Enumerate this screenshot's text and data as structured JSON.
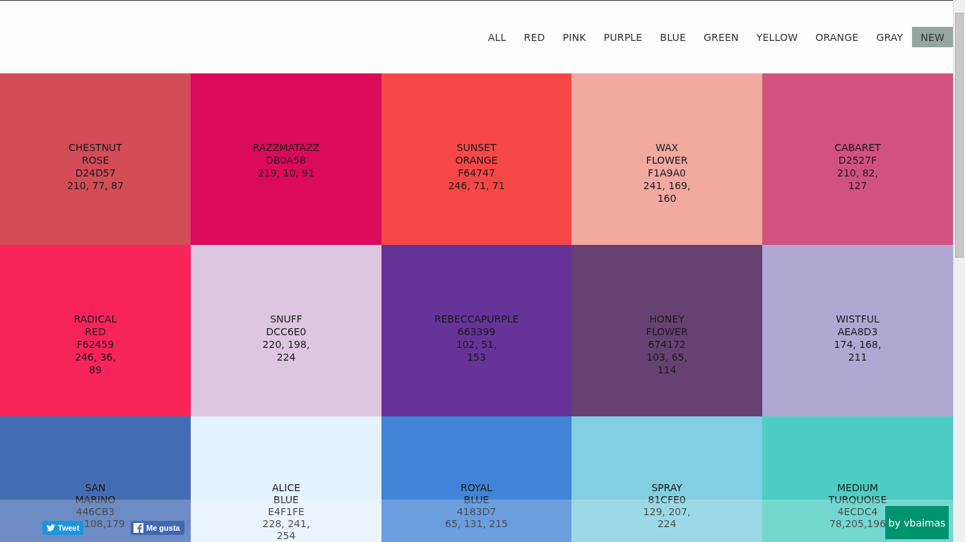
{
  "nav": [
    {
      "label": "ALL",
      "selected": false
    },
    {
      "label": "RED",
      "selected": false
    },
    {
      "label": "PINK",
      "selected": false
    },
    {
      "label": "PURPLE",
      "selected": false
    },
    {
      "label": "BLUE",
      "selected": false
    },
    {
      "label": "GREEN",
      "selected": false
    },
    {
      "label": "YELLOW",
      "selected": false
    },
    {
      "label": "ORANGE",
      "selected": false
    },
    {
      "label": "GRAY",
      "selected": false
    },
    {
      "label": "NEW",
      "selected": true
    }
  ],
  "swatches": [
    {
      "color": "#d24d57",
      "lines": [
        "CHESTNUT",
        "ROSE",
        "D24D57",
        "210, 77, 87"
      ]
    },
    {
      "color": "#db0a5b",
      "lines": [
        "RAZZMATAZZ",
        "DB0A5B",
        "219, 10, 91"
      ]
    },
    {
      "color": "#f64747",
      "lines": [
        "SUNSET",
        "ORANGE",
        "F64747",
        "246, 71, 71"
      ]
    },
    {
      "color": "#f1a9a0",
      "lines": [
        "WAX",
        "FLOWER",
        "F1A9A0",
        "241, 169,",
        "160"
      ]
    },
    {
      "color": "#d2527f",
      "lines": [
        "CABARET",
        "D2527F",
        "210, 82,",
        "127"
      ]
    },
    {
      "color": "#f62459",
      "lines": [
        "RADICAL",
        "RED",
        "F62459",
        "246, 36,",
        "89"
      ]
    },
    {
      "color": "#dcc6e0",
      "lines": [
        "SNUFF",
        "DCC6E0",
        "220, 198,",
        "224"
      ]
    },
    {
      "color": "#663399",
      "lines": [
        "REBECCAPURPLE",
        "663399",
        "102, 51,",
        "153"
      ]
    },
    {
      "color": "#674172",
      "lines": [
        "HONEY",
        "FLOWER",
        "674172",
        "103, 65,",
        "114"
      ]
    },
    {
      "color": "#aea8d3",
      "lines": [
        "WISTFUL",
        "AEA8D3",
        "174, 168,",
        "211"
      ]
    },
    {
      "color": "#446cb3",
      "lines": [
        "SAN",
        "MARINO",
        "446CB3",
        "108,179"
      ]
    },
    {
      "color": "#e4f1fe",
      "lines": [
        "ALICE",
        "BLUE",
        "E4F1FE",
        "228, 241,",
        "254"
      ]
    },
    {
      "color": "#4183d7",
      "lines": [
        "ROYAL",
        "BLUE",
        "4183D7",
        "65, 131, 215"
      ]
    },
    {
      "color": "#81cfe0",
      "lines": [
        "SPRAY",
        "81CFE0",
        "129, 207,",
        "224"
      ]
    },
    {
      "color": "#4ecdc4",
      "lines": [
        "MEDIUM",
        "TURQUOISE",
        "4ECDC4",
        "78,205,196"
      ]
    }
  ],
  "share": {
    "tweet": "Tweet",
    "like": "Me gusta"
  },
  "credit": "by vbaimas"
}
